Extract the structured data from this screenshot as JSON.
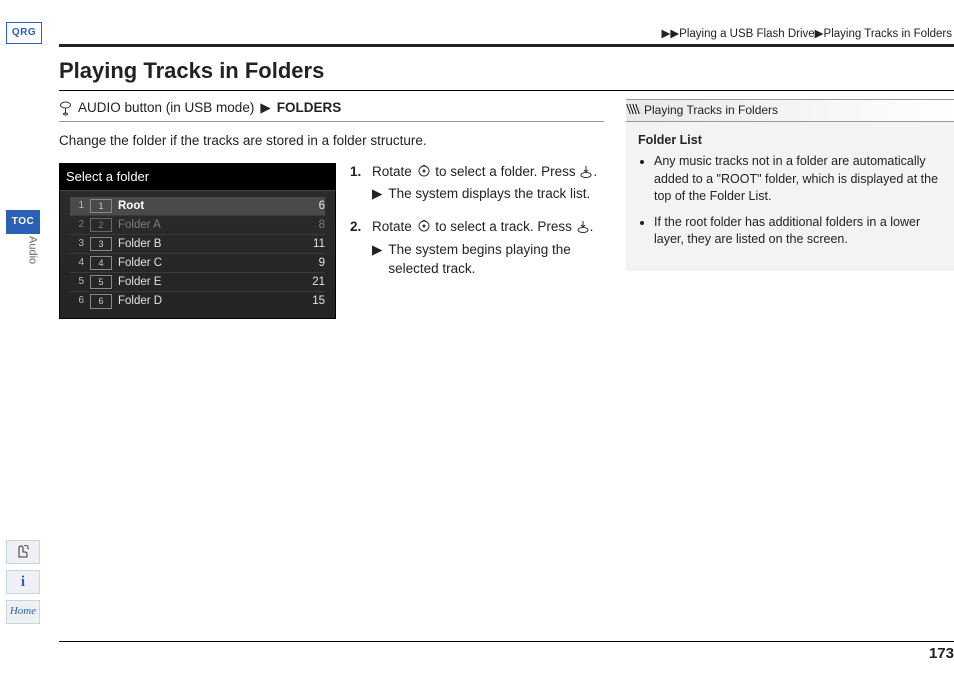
{
  "side": {
    "qrg": "QRG",
    "toc": "TOC",
    "audio": "Audio",
    "hand_icon": "hand-pointer-icon",
    "info": "i",
    "home": "Home"
  },
  "breadcrumb": {
    "arrows": "▶▶",
    "part1": "Playing a USB Flash Drive",
    "arrow2": "▶",
    "part2": "Playing Tracks in Folders"
  },
  "title": "Playing Tracks in Folders",
  "navline": {
    "prefix": "AUDIO button (in USB mode)",
    "sep": "▶",
    "cmd": "FOLDERS"
  },
  "intro": "Change the folder if the tracks are stored in a folder structure.",
  "steps": [
    {
      "num": "1.",
      "text_a": "Rotate ",
      "text_b": " to select a folder. Press ",
      "text_c": ".",
      "result_arrow": "▶",
      "result": "The system displays the track list."
    },
    {
      "num": "2.",
      "text_a": "Rotate ",
      "text_b": " to select a track. Press ",
      "text_c": ".",
      "result_arrow": "▶",
      "result": "The system begins playing the selected track."
    }
  ],
  "screenshot": {
    "title": "Select a folder",
    "rows": [
      {
        "idx": "1",
        "box": "1",
        "name": "Root",
        "count": "6",
        "state": "sel"
      },
      {
        "idx": "2",
        "box": "2",
        "name": "Folder A",
        "count": "8",
        "state": "dim"
      },
      {
        "idx": "3",
        "box": "3",
        "name": "Folder B",
        "count": "11",
        "state": ""
      },
      {
        "idx": "4",
        "box": "4",
        "name": "Folder C",
        "count": "9",
        "state": ""
      },
      {
        "idx": "5",
        "box": "5",
        "name": "Folder E",
        "count": "21",
        "state": ""
      },
      {
        "idx": "6",
        "box": "6",
        "name": "Folder D",
        "count": "15",
        "state": ""
      }
    ]
  },
  "sidebar": {
    "head": "Playing Tracks in Folders",
    "panel_title": "Folder List",
    "bullets": [
      "Any music tracks not in a folder are automatically added to a \"ROOT\" folder, which is displayed at the top of the Folder List.",
      "If the root folder has additional folders in a lower layer, they are listed on the screen."
    ]
  },
  "page_number": "173"
}
